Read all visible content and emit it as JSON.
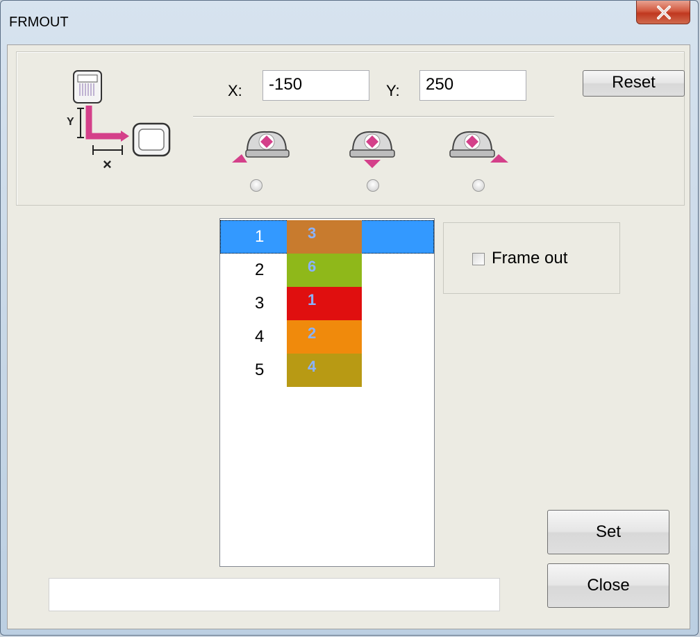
{
  "window": {
    "title": "FRMOUT",
    "close_glyph": "x"
  },
  "icons": {
    "machine_axis": "machine-xy-offset-icon",
    "frame_left": "frame-out-left-icon",
    "frame_down": "frame-out-down-icon",
    "frame_right": "frame-out-right-icon",
    "axis_y_label": "Y",
    "axis_x_label": "×"
  },
  "offset": {
    "x_label": "X:",
    "x_value": "-150",
    "y_label": "Y:",
    "y_value": "250",
    "reset_label": "Reset"
  },
  "direction_radios": [
    {
      "name": "left",
      "selected": false
    },
    {
      "name": "down",
      "selected": false
    },
    {
      "name": "right",
      "selected": false
    }
  ],
  "color_list": {
    "selected_index": 0,
    "items": [
      {
        "index": "1",
        "needle": "3",
        "color": "#c87b2e"
      },
      {
        "index": "2",
        "needle": "6",
        "color": "#8fb81a"
      },
      {
        "index": "3",
        "needle": "1",
        "color": "#e00f0f"
      },
      {
        "index": "4",
        "needle": "2",
        "color": "#f08a0c"
      },
      {
        "index": "5",
        "needle": "4",
        "color": "#b89a14"
      }
    ]
  },
  "frame_out": {
    "label": "Frame out",
    "checked": false
  },
  "buttons": {
    "set_label": "Set",
    "close_label": "Close"
  },
  "status_text": "",
  "colors": {
    "selection": "#3399ff",
    "accent_pink": "#d4408a"
  }
}
